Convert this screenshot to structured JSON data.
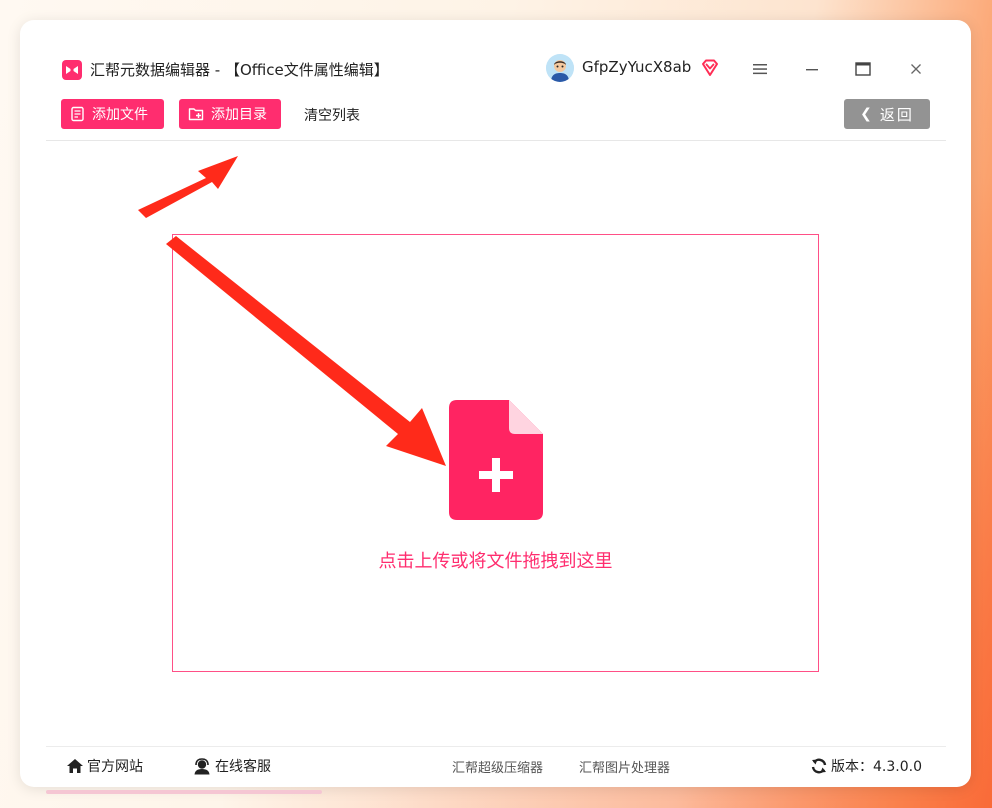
{
  "window": {
    "title": "汇帮元数据编辑器 - 【Office文件属性编辑】",
    "username": "GfpZyYucX8ab"
  },
  "toolbar": {
    "add_file_label": "添加文件",
    "add_folder_label": "添加目录",
    "clear_list_label": "清空列表",
    "back_label": "返回"
  },
  "dropzone": {
    "hint": "点击上传或将文件拖拽到这里"
  },
  "footer": {
    "website_label": "官方网站",
    "support_label": "在线客服",
    "link_compressor": "汇帮超级压缩器",
    "link_image_processor": "汇帮图片处理器",
    "version_label": "版本：4.3.0.0"
  },
  "icons": {
    "app": "app-logo-icon",
    "vip": "vip-diamond-icon",
    "menu": "hamburger-icon",
    "minimize": "minimize-icon",
    "maximize": "maximize-icon",
    "close": "close-icon",
    "add_file": "document-icon",
    "add_folder": "folder-add-icon",
    "upload": "file-plus-icon",
    "home": "home-icon",
    "support": "headset-icon",
    "refresh": "refresh-icon"
  },
  "colors": {
    "accent": "#ff2d6f",
    "back_button": "#939393",
    "annotation_arrow": "#ff2a1a"
  }
}
